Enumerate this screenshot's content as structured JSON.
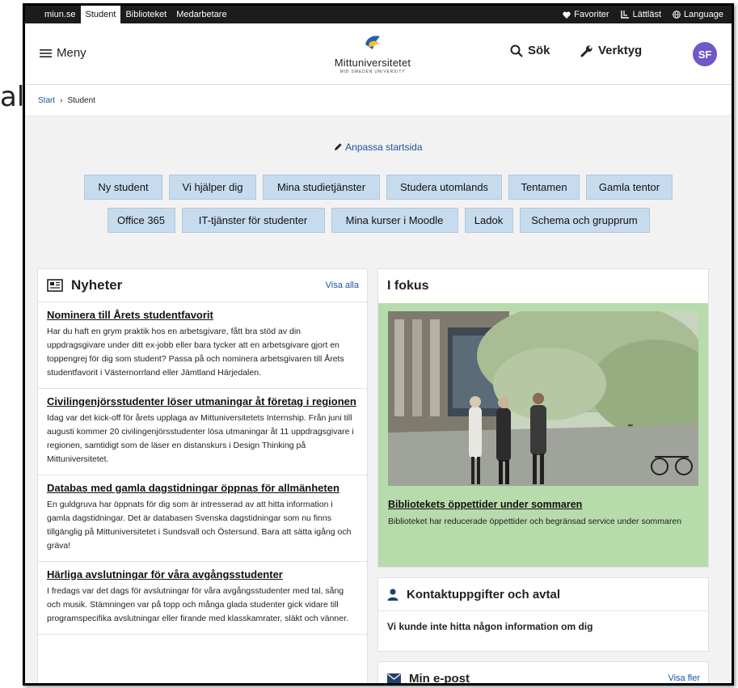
{
  "stray_text": "al",
  "topbar": {
    "links": [
      "miun.se",
      "Student",
      "Biblioteket",
      "Medarbetare"
    ],
    "favorites": "Favoriter",
    "easy_read": "Lättläst",
    "language": "Language"
  },
  "header": {
    "menu": "Meny",
    "logo_name": "Mittuniversitetet",
    "logo_sub": "MID SWEDEN UNIVERSITY",
    "search": "Sök",
    "tools": "Verktyg",
    "avatar": "SF"
  },
  "breadcrumb": {
    "start": "Start",
    "sep": "›",
    "current": "Student"
  },
  "customize": "Anpassa startsida",
  "quick_links_row1": [
    "Ny student",
    "Vi hjälper dig",
    "Mina studietjänster",
    "Studera utomlands",
    "Tentamen",
    "Gamla tentor"
  ],
  "quick_links_row2": [
    "Office 365",
    "IT-tjänster för studenter",
    "Mina kurser i Moodle",
    "Ladok",
    "Schema och grupprum"
  ],
  "news": {
    "title": "Nyheter",
    "show_all": "Visa alla",
    "articles": [
      {
        "title": "Nominera till Årets studentfavorit",
        "body": "Har du haft en grym praktik hos en arbetsgivare, fått bra stöd av din uppdragsgivare under ditt ex-jobb eller bara tycker att en arbetsgivare gjort en toppengrej för dig som student? Passa på och nominera arbetsgivaren till Årets studentfavorit i Västernorrland eller Jämtland Härjedalen."
      },
      {
        "title": "Civilingenjörsstudenter löser utmaningar åt företag i regionen",
        "body": "Idag var det kick-off för årets upplaga av Mittuniversitetets Internship. Från juni till augusti kommer 20 civilingenjörsstudenter lösa utmaningar åt 11 uppdragsgivare i regionen, samtidigt som de läser en distanskurs i Design Thinking på Mittuniversitetet."
      },
      {
        "title": "Databas med gamla dagstidningar öppnas för allmänheten",
        "body": "En guldgruva har öppnats för dig som är intresserad av att hitta information i gamla dagstidningar. Det är databasen Svenska dagstidningar som nu finns tillgänglig på Mittuniversitetet i Sundsvall och Östersund. Bara att sätta igång och gräva!"
      },
      {
        "title": "Härliga avslutningar för våra avgångsstudenter",
        "body": "I fredags var det dags för avslutningar för våra avgångsstudenter med tal, sång och musik. Stämningen var på topp och många glada studenter gick vidare till programspecifika avslutningar eller firande med klasskamrater, släkt och vänner."
      }
    ]
  },
  "focus": {
    "title": "I fokus",
    "item_title": "Bibliotekets öppettider under sommaren",
    "item_body": "Biblioteket har reducerade öppettider och begränsad service under sommaren"
  },
  "contact": {
    "title": "Kontaktuppgifter och avtal",
    "message": "Vi kunde inte hitta någon information om dig"
  },
  "mail": {
    "title": "Min e-post",
    "show_more": "Visa fler"
  },
  "colors": {
    "avatar": "#6f58c9",
    "quick_link_bg": "#c7dbee",
    "focus_bg": "#b6dcab",
    "link": "#1a55a0",
    "topbar": "#1c1c1c"
  }
}
